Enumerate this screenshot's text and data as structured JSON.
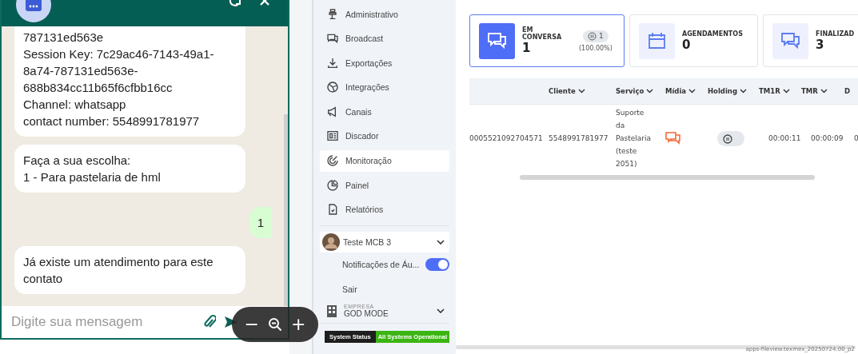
{
  "chat": {
    "messages": [
      {
        "kind": "incoming",
        "lines": [
          "787131ed563e",
          "Session Key: 7c29ac46-7143-49a1-",
          "8a74-787131ed563e-",
          "688b834cc11b65f6cfbb16cc",
          "Channel: whatsapp",
          "contact number: 5548991781977"
        ]
      },
      {
        "kind": "incoming",
        "lines": [
          "Faça a sua escolha:",
          "1 - Para pastelaria de hml"
        ]
      },
      {
        "kind": "outgoing",
        "lines": [
          "1"
        ]
      },
      {
        "kind": "incoming",
        "lines": [
          "Já existe um atendimento para este contato"
        ]
      }
    ],
    "input": {
      "placeholder": "Digite sua mensagem"
    }
  },
  "sidebar": {
    "items": [
      {
        "label": "Administrativo",
        "selected": false
      },
      {
        "label": "Broadcast",
        "selected": false
      },
      {
        "label": "Exportações",
        "selected": false
      },
      {
        "label": "Integrações",
        "selected": false
      },
      {
        "label": "Canais",
        "selected": false
      },
      {
        "label": "Discador",
        "selected": false
      },
      {
        "label": "Monitoração",
        "selected": true
      },
      {
        "label": "Painel",
        "selected": false
      },
      {
        "label": "Relatórios",
        "selected": false
      }
    ],
    "user": {
      "name": "Teste MCB 3",
      "expanded": true
    },
    "notifications": {
      "label": "Notificações de Áu...",
      "on": true
    },
    "logout": "Sair",
    "company": {
      "caption": "EMPRESA",
      "name": "GOD MODE"
    },
    "status": {
      "label": "System Status",
      "value": "All Systems Operational"
    }
  },
  "cards": [
    {
      "title": "EM CONVERSA",
      "value": "1",
      "selected": true,
      "badge": "1",
      "percent": "(100.00%)"
    },
    {
      "title": "AGENDAMENTOS",
      "value": "0",
      "selected": false
    },
    {
      "title": "FINALIZAD",
      "value": "3",
      "selected": false
    }
  ],
  "table": {
    "columns": [
      "",
      "Cliente",
      "Serviço",
      "Mídia",
      "Holding",
      "TM1R",
      "TMR",
      "D"
    ],
    "rows": [
      {
        "column_1": "0005521092704571",
        "cliente": "5548991781977",
        "servico": "Suporte da Pastelaria (teste 2051)",
        "tm1r": "00:00:11",
        "tmr": "00:00:09",
        "column_8": "0"
      }
    ]
  },
  "viewer": {
    "zoom_out": "−",
    "zoom_in": "+",
    "file": "apps-fileview.texmex_20250724.00_p2"
  }
}
